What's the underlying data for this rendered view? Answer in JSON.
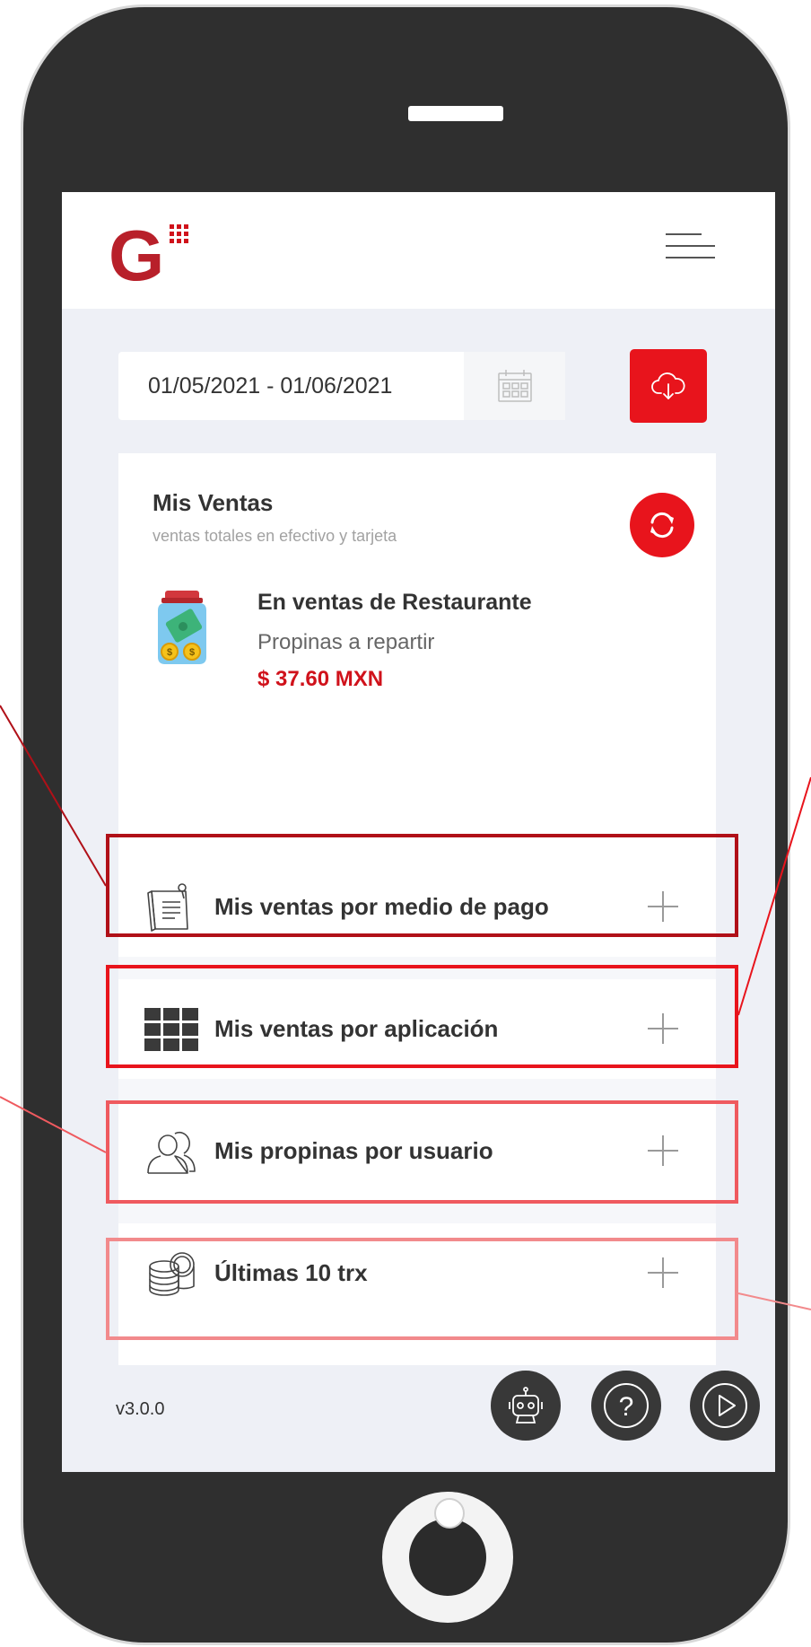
{
  "header": {
    "logo_letter": "G",
    "brand_color": "#b8202a"
  },
  "filter": {
    "date_range_value": "01/05/2021 - 01/06/2021",
    "calendar_icon": "calendar-icon",
    "download_icon": "cloud-download-icon",
    "accent_color": "#e8141c"
  },
  "summary": {
    "title": "Mis Ventas",
    "subtitle": "ventas totales en efectivo y tarjeta",
    "restaurant_title": "En ventas de Restaurante",
    "tips_label": "Propinas a repartir",
    "tips_amount": "$ 37.60 MXN"
  },
  "sections": [
    {
      "label": "Mis ventas por medio de pago",
      "icon": "receipt-icon"
    },
    {
      "label": "Mis ventas por aplicación",
      "icon": "grid-icon"
    },
    {
      "label": "Mis propinas por usuario",
      "icon": "users-icon"
    },
    {
      "label": "Últimas 10 trx",
      "icon": "coins-icon"
    }
  ],
  "footer": {
    "version": "v3.0.0",
    "buttons": [
      "bot-icon",
      "help-icon",
      "play-icon"
    ]
  },
  "annotation_colors": [
    "#b01018",
    "#e8141c",
    "#ef5a5f",
    "#f28a8c"
  ]
}
